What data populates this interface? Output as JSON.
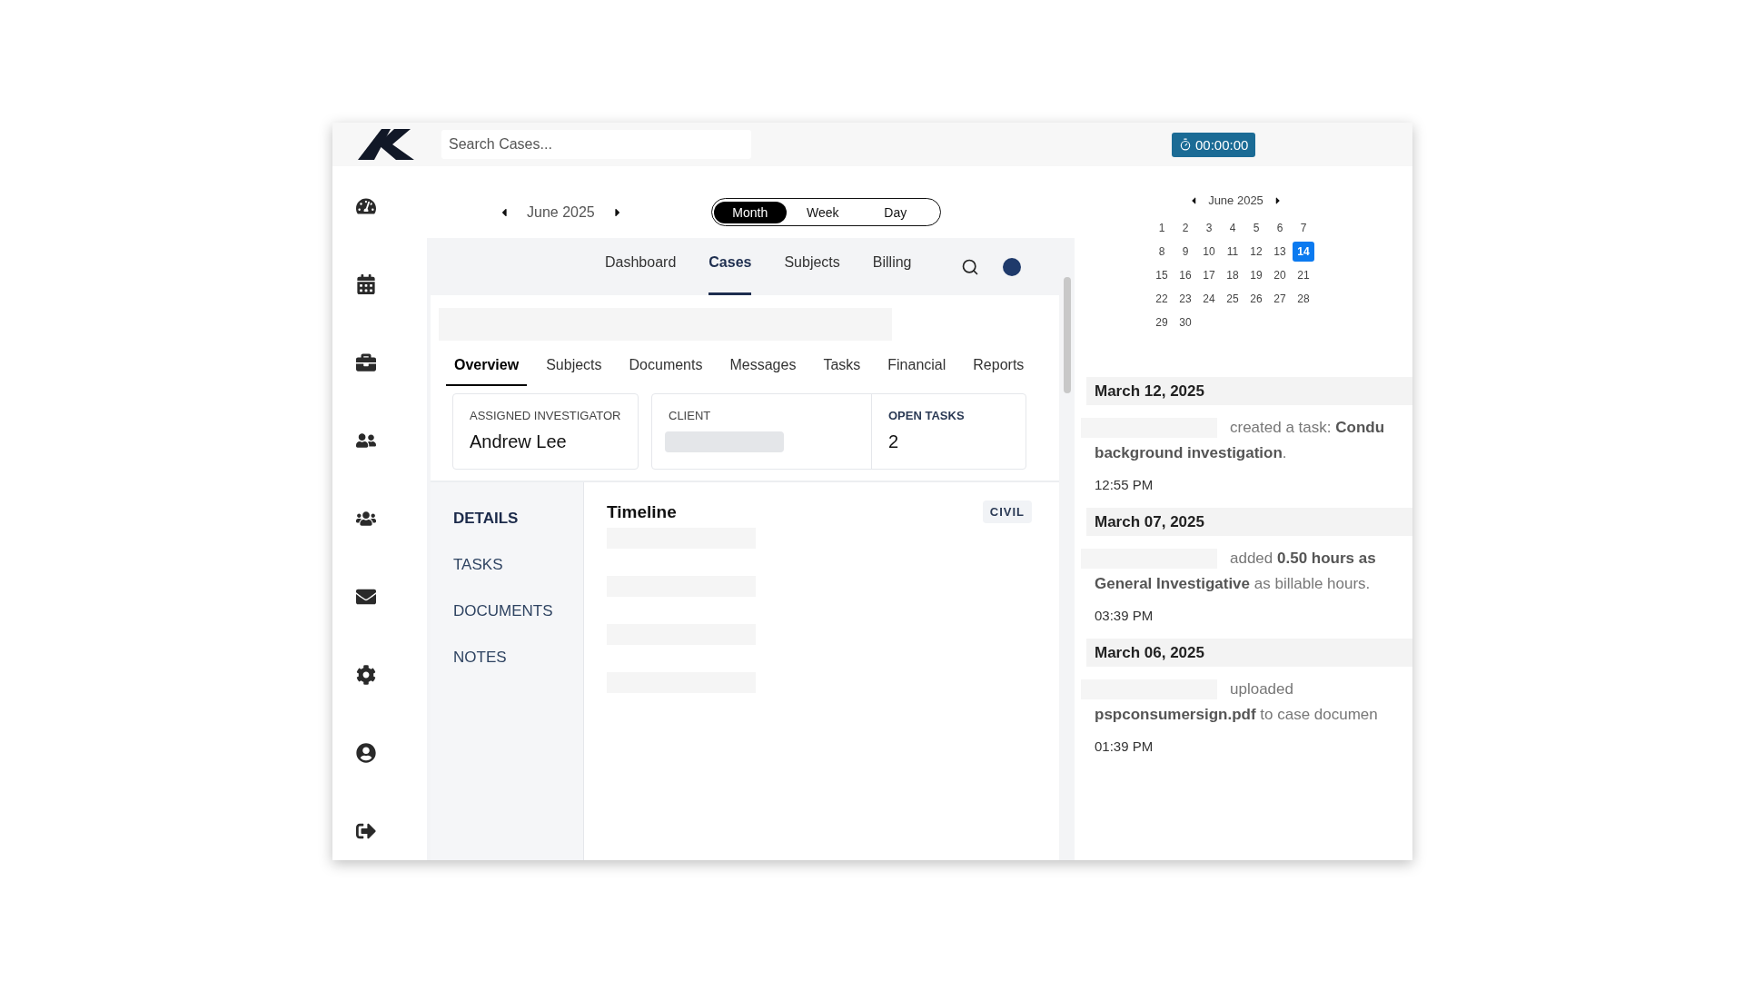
{
  "search": {
    "placeholder": "Search Cases..."
  },
  "timer": {
    "label": "00:00:00"
  },
  "calendar_nav": {
    "month": "June 2025"
  },
  "view_switch": [
    {
      "label": "Month",
      "selected": true
    },
    {
      "label": "Week",
      "selected": false
    },
    {
      "label": "Day",
      "selected": false
    }
  ],
  "top_nav": [
    {
      "label": "Dashboard",
      "selected": false
    },
    {
      "label": "Cases",
      "selected": true
    },
    {
      "label": "Subjects",
      "selected": false
    },
    {
      "label": "Billing",
      "selected": false
    }
  ],
  "case_tabs": [
    {
      "label": "Overview",
      "selected": true
    },
    {
      "label": "Subjects",
      "selected": false
    },
    {
      "label": "Documents",
      "selected": false
    },
    {
      "label": "Messages",
      "selected": false
    },
    {
      "label": "Tasks",
      "selected": false
    },
    {
      "label": "Financial",
      "selected": false
    },
    {
      "label": "Reports",
      "selected": false
    }
  ],
  "stats": [
    {
      "label": "ASSIGNED INVESTIGATOR",
      "value": "Andrew Lee"
    },
    {
      "label": "CLIENT"
    },
    {
      "label": "OPEN TASKS",
      "value": "2"
    }
  ],
  "section_nav": [
    {
      "label": "DETAILS",
      "selected": true
    },
    {
      "label": "TASKS",
      "selected": false
    },
    {
      "label": "DOCUMENTS",
      "selected": false
    },
    {
      "label": "NOTES",
      "selected": false
    }
  ],
  "timeline": {
    "title": "Timeline",
    "tag": "CIVIL"
  },
  "mini_calendar": {
    "month": "June 2025",
    "days": [
      {
        "label": "1",
        "selected": false
      },
      {
        "label": "2",
        "selected": false
      },
      {
        "label": "3",
        "selected": false
      },
      {
        "label": "4",
        "selected": false
      },
      {
        "label": "5",
        "selected": false
      },
      {
        "label": "6",
        "selected": false
      },
      {
        "label": "7",
        "selected": false
      },
      {
        "label": "8",
        "selected": false
      },
      {
        "label": "9",
        "selected": false
      },
      {
        "label": "10",
        "selected": false
      },
      {
        "label": "11",
        "selected": false
      },
      {
        "label": "12",
        "selected": false
      },
      {
        "label": "13",
        "selected": false
      },
      {
        "label": "14",
        "selected": true
      },
      {
        "label": "15",
        "selected": false
      },
      {
        "label": "16",
        "selected": false
      },
      {
        "label": "17",
        "selected": false
      },
      {
        "label": "18",
        "selected": false
      },
      {
        "label": "19",
        "selected": false
      },
      {
        "label": "20",
        "selected": false
      },
      {
        "label": "21",
        "selected": false
      },
      {
        "label": "22",
        "selected": false
      },
      {
        "label": "23",
        "selected": false
      },
      {
        "label": "24",
        "selected": false
      },
      {
        "label": "25",
        "selected": false
      },
      {
        "label": "26",
        "selected": false
      },
      {
        "label": "27",
        "selected": false
      },
      {
        "label": "28",
        "selected": false
      },
      {
        "label": "29",
        "selected": false
      },
      {
        "label": "30",
        "selected": false
      }
    ]
  },
  "activity": [
    {
      "date": "March 12, 2025",
      "lines": [
        "created a task: **Condu**",
        "**background investigation**."
      ],
      "time": "12:55 PM"
    },
    {
      "date": "March 07, 2025",
      "lines": [
        "added **0.50 hours as**",
        "**General Investigative** as billable hours."
      ],
      "time": "03:39 PM"
    },
    {
      "date": "March 06, 2025",
      "lines": [
        "uploaded",
        "**pspconsumersign.pdf** to case documen"
      ],
      "time": "01:39 PM"
    }
  ]
}
